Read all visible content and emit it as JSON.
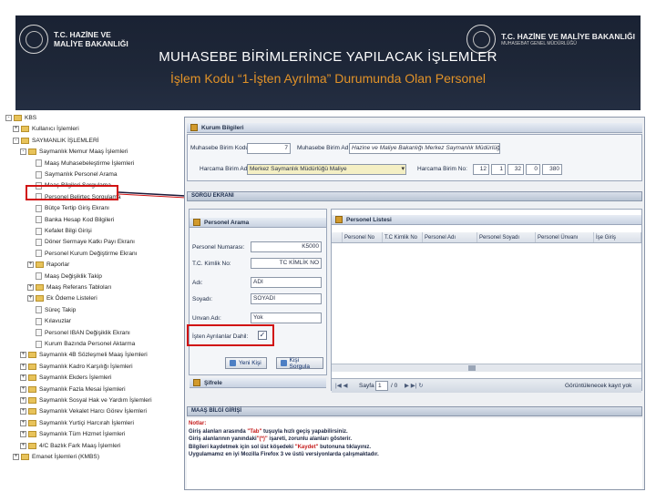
{
  "banner": {
    "logo_left_line1": "T.C. HAZİNE VE",
    "logo_left_line2": "MALİYE BAKANLIĞI",
    "logo_right_line1": "T.C. HAZİNE VE MALİYE BAKANLIĞI",
    "logo_right_line2": "MUHASEBAT GENEL MÜDÜRLÜĞÜ",
    "title": "MUHASEBE BİRİMLERİNCE YAPILACAK İŞLEMLER",
    "subtitle": "İşlem Kodu “1-İşten Ayrılma” Durumunda Olan Personel"
  },
  "tree": {
    "items": [
      {
        "label": "KBS",
        "indent": 0,
        "expander": "-",
        "kind": "folder"
      },
      {
        "label": "Kullanıcı İşlemleri",
        "indent": 1,
        "expander": "+",
        "kind": "folder"
      },
      {
        "label": "SAYMANLIK İŞLEMLERİ",
        "indent": 1,
        "expander": "-",
        "kind": "folder"
      },
      {
        "label": "Saymanlık Memur Maaş İşlemleri",
        "indent": 2,
        "expander": "-",
        "kind": "folder"
      },
      {
        "label": "Maaş Muhasebeleştirme İşlemleri",
        "indent": 3,
        "expander": "",
        "kind": "file"
      },
      {
        "label": "Saymanlık Personel Arama",
        "indent": 3,
        "expander": "",
        "kind": "file"
      },
      {
        "label": "Maaş Bilgileri Sorgulama",
        "indent": 3,
        "expander": "",
        "kind": "file"
      },
      {
        "label": "Personel Belirteç Sorgulama",
        "indent": 3,
        "expander": "",
        "kind": "file"
      },
      {
        "label": "Bütçe Tertip Giriş Ekranı",
        "indent": 3,
        "expander": "",
        "kind": "file"
      },
      {
        "label": "Banka Hesap Kod Bilgileri",
        "indent": 3,
        "expander": "",
        "kind": "file"
      },
      {
        "label": "Kefalet Bilgi Girişi",
        "indent": 3,
        "expander": "",
        "kind": "file"
      },
      {
        "label": "Döner Sermaye Katkı Payı Ekranı",
        "indent": 3,
        "expander": "",
        "kind": "file"
      },
      {
        "label": "Personel Kurum Değiştirme Ekranı",
        "indent": 3,
        "expander": "",
        "kind": "file"
      },
      {
        "label": "Raporlar",
        "indent": 3,
        "expander": "+",
        "kind": "folder"
      },
      {
        "label": "Maaş Değişiklik Takip",
        "indent": 3,
        "expander": "",
        "kind": "file"
      },
      {
        "label": "Maaş Referans Tabloları",
        "indent": 3,
        "expander": "+",
        "kind": "folder"
      },
      {
        "label": "Ek Ödeme Listeleri",
        "indent": 3,
        "expander": "+",
        "kind": "folder"
      },
      {
        "label": "Süreç Takip",
        "indent": 3,
        "expander": "",
        "kind": "file"
      },
      {
        "label": "Kılavuzlar",
        "indent": 3,
        "expander": "",
        "kind": "file"
      },
      {
        "label": "Personel IBAN Değişiklik Ekranı",
        "indent": 3,
        "expander": "",
        "kind": "file"
      },
      {
        "label": "Kurum Bazında Personel Aktarma",
        "indent": 3,
        "expander": "",
        "kind": "file"
      },
      {
        "label": "Saymanlık 4B Sözleşmeli Maaş İşlemleri",
        "indent": 2,
        "expander": "+",
        "kind": "folder"
      },
      {
        "label": "Saymanlık Kadro Karşılığı İşlemleri",
        "indent": 2,
        "expander": "+",
        "kind": "folder"
      },
      {
        "label": "Saymanlık Ekders İşlemleri",
        "indent": 2,
        "expander": "+",
        "kind": "folder"
      },
      {
        "label": "Saymanlık Fazla Mesai İşlemleri",
        "indent": 2,
        "expander": "+",
        "kind": "folder"
      },
      {
        "label": "Saymanlık Sosyal Hak ve Yardım İşlemleri",
        "indent": 2,
        "expander": "+",
        "kind": "folder"
      },
      {
        "label": "Saymanlık Vekalet Harcı Görev İşlemleri",
        "indent": 2,
        "expander": "+",
        "kind": "folder"
      },
      {
        "label": "Saymanlık Yurtiçi Harcırah İşlemleri",
        "indent": 2,
        "expander": "+",
        "kind": "folder"
      },
      {
        "label": "Saymanlık Tüm Hizmet İşlemleri",
        "indent": 2,
        "expander": "+",
        "kind": "folder"
      },
      {
        "label": "4/C Bazlık Fark Maaş İşlemleri",
        "indent": 2,
        "expander": "+",
        "kind": "folder"
      },
      {
        "label": "Emanet İşlemleri (KMBS)",
        "indent": 1,
        "expander": "+",
        "kind": "folder"
      }
    ]
  },
  "kurum": {
    "header": "Kurum Bilgileri",
    "muhasebe_kodu_label": "Muhasebe Birim Kodu:",
    "muhasebe_kodu_value": "7",
    "muhasebe_adi_label": "Muhasebe Birim Adı:",
    "muhasebe_adi_value": "Hazine ve Maliye Bakanlığı Merkez Saymanlık Müdürlüğü",
    "harcama_adi_label": "Harcama Birim Adı:",
    "harcama_adi_value": "Merkez Saymanlık Müdürlüğü Maliye",
    "harcama_no_label": "Harcama Birim No:",
    "harcama_no_values": [
      "12",
      "1",
      "32",
      "0",
      "380"
    ]
  },
  "sorgu": {
    "header": "SORGU EKRANI"
  },
  "arama": {
    "header": "Personel Arama",
    "personel_no_label": "Personel Numarası:",
    "personel_no_value": "K5000",
    "tc_label": "T.C. Kimlik No:",
    "tc_value": "TC KİMLİK NO",
    "adi_label": "Adı:",
    "adi_value": "ADI",
    "soyadi_label": "Soyadı:",
    "soyadi_value": "SOYADI",
    "unvan_label": "Unvan Adı:",
    "unvan_value": "Yok",
    "isten_label": "İşten Ayrılanlar Dahil:",
    "isten_checked": "✓",
    "btn_yeni": "Yeni Kişi",
    "btn_sorgula": "Kişi Sorgula",
    "footer": "Şifrele"
  },
  "liste": {
    "header": "Personel Listesi",
    "columns": [
      "Personel No",
      "T.C Kimlik No",
      "Personel Adı",
      "Personel Soyadı",
      "Personel Ünvanı",
      "İşe Giriş"
    ],
    "page_label": "Sayfa",
    "page_value": "1",
    "page_of": "/ 0",
    "no_records": "Görüntülenecek kayıt yok"
  },
  "maas": {
    "header": "MAAŞ BİLGİ GİRİŞİ",
    "notes_title": "Notlar:",
    "note1_a": "Giriş alanları arasında",
    "note1_q": "\"Tab\"",
    "note1_b": "tuşuyla hızlı geçiş yapabilirsiniz.",
    "note2_a": "Giriş alanlarının yanındaki",
    "note2_q": "\"(*)\"",
    "note2_b": "işareti, zorunlu alanları gösterir.",
    "note3_a": "Bilgileri kaydetmek için sol üst köşedeki",
    "note3_q": "\"Kaydet\"",
    "note3_b": "butonuna tıklayınız.",
    "note4": "Uygulamamız en iyi Mozilla Firefox 3 ve üstü versiyonlarda çalışmaktadır."
  },
  "colors": {
    "banner": "#1e2738",
    "subtitle": "#e19228",
    "highlight": "#d11212"
  }
}
